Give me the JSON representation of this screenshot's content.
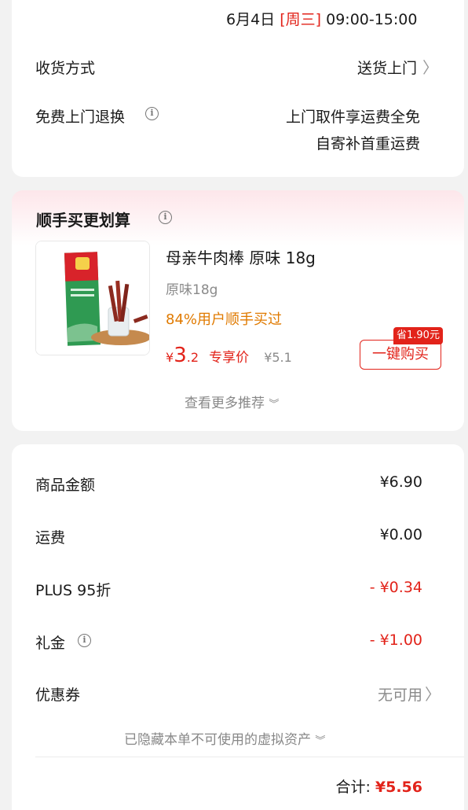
{
  "delivery": {
    "date": "6月4日",
    "weekday": "[周三]",
    "time": "09:00-15:00",
    "receive_label": "收货方式",
    "receive_value": "送货上门",
    "return_label": "免费上门退换",
    "return_value_line1": "上门取件享运费全免",
    "return_value_line2": "自寄补首重运费"
  },
  "addon": {
    "title": "顺手买更划算",
    "product_name": "母亲牛肉棒 原味 18g",
    "spec": "原味18g",
    "social_proof": "84%用户顺手买过",
    "price_symbol": "¥",
    "price_int": "3",
    "price_dec": ".2",
    "price_tag": "专享价",
    "original_price": "¥5.1",
    "save_badge": "省1.90元",
    "buy_button": "一键购买",
    "more": "查看更多推荐"
  },
  "summary": {
    "items": [
      {
        "label": "商品金额",
        "value": "¥6.90"
      },
      {
        "label": "运费",
        "value": "¥0.00"
      },
      {
        "label": "PLUS 95折",
        "value": "- ¥0.34"
      },
      {
        "label": "礼金",
        "value": "- ¥1.00"
      },
      {
        "label": "优惠券",
        "value": "无可用"
      }
    ],
    "hidden_note": "已隐藏本单不可使用的虚拟资产",
    "total_label": "合计:",
    "total_value": "¥5.56"
  },
  "colors": {
    "accent": "#e2231a",
    "orange": "#e07a00",
    "muted": "#8a8a8a"
  },
  "icons": [
    "info-icon",
    "chevron-right-icon",
    "chevron-down-icon"
  ]
}
